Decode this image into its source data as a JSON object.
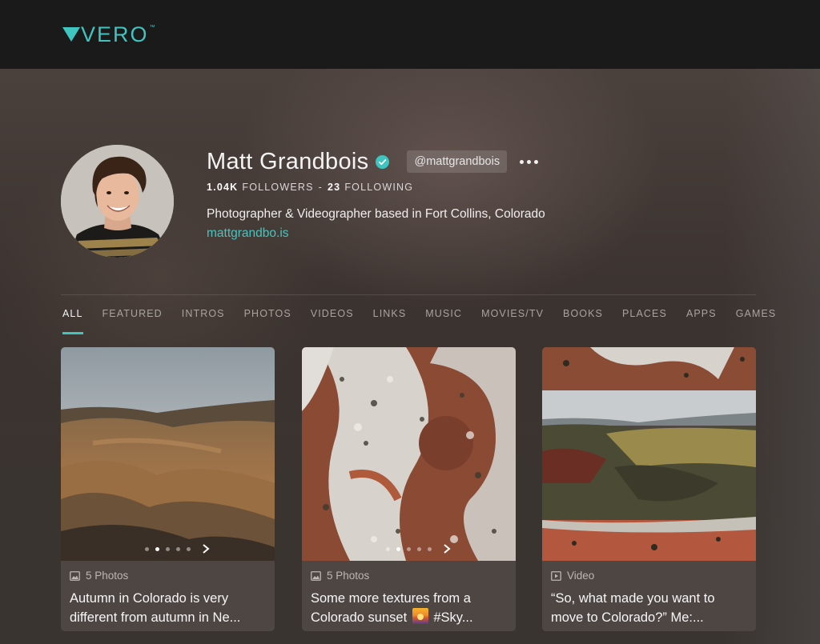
{
  "brand": {
    "name": "VERO",
    "accent": "#40c4c0"
  },
  "profile": {
    "name": "Matt Grandbois",
    "verified": true,
    "handle": "@mattgrandbois",
    "followers_count": "1.04K",
    "followers_label": "FOLLOWERS",
    "following_count": "23",
    "following_label": "FOLLOWING",
    "separator": "-",
    "bio": "Photographer & Videographer based in Fort Collins, Colorado",
    "website": "mattgrandbo.is"
  },
  "tabs": [
    {
      "label": "ALL",
      "active": true
    },
    {
      "label": "FEATURED"
    },
    {
      "label": "INTROS"
    },
    {
      "label": "PHOTOS"
    },
    {
      "label": "VIDEOS"
    },
    {
      "label": "LINKS"
    },
    {
      "label": "MUSIC"
    },
    {
      "label": "MOVIES/TV"
    },
    {
      "label": "BOOKS"
    },
    {
      "label": "PLACES"
    },
    {
      "label": "APPS"
    },
    {
      "label": "GAMES"
    }
  ],
  "posts": [
    {
      "type_label": "5 Photos",
      "type_icon": "photo-icon",
      "title": "Autumn in Colorado is very different from autumn in Ne...",
      "carousel_count": 5,
      "carousel_active": 1
    },
    {
      "type_label": "5 Photos",
      "type_icon": "photo-icon",
      "title_part1": "Some more textures from a Colorado sunset",
      "title_emoji": "sunset-emoji",
      "title_part2": "#Sky...",
      "carousel_count": 5,
      "carousel_active": 1
    },
    {
      "type_label": "Video",
      "type_icon": "video-icon",
      "title": "“So, what made you want to move to Colorado?” Me:..."
    }
  ]
}
